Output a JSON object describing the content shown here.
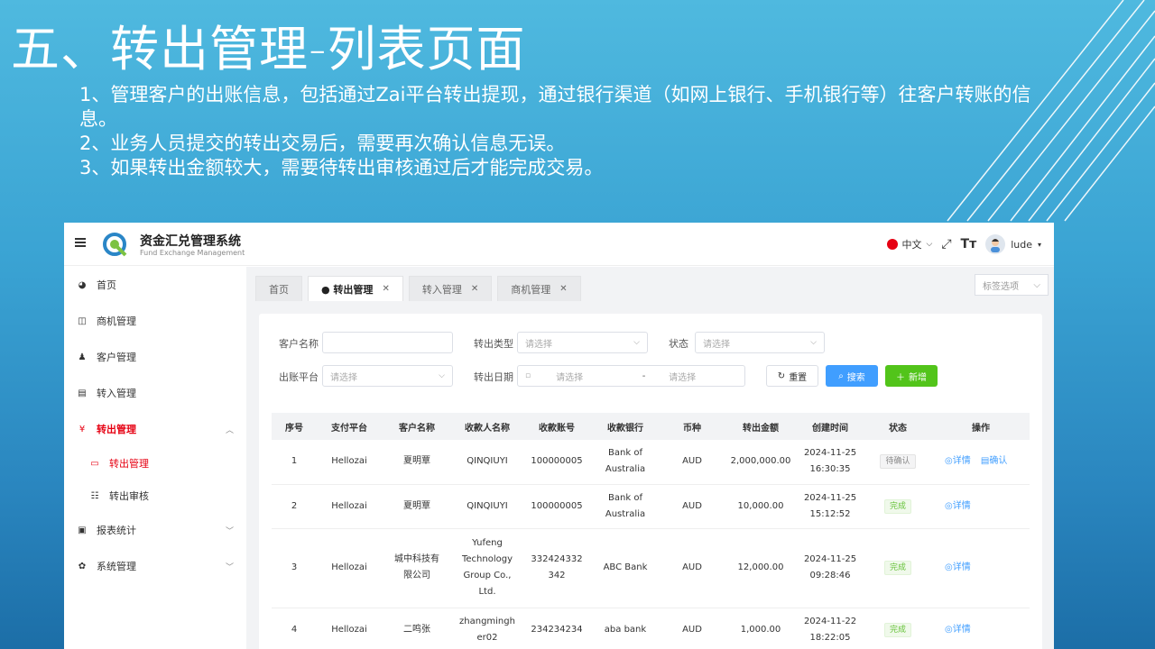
{
  "slide": {
    "title": "五、转出管理-列表页面",
    "bullets": [
      "1、管理客户的出账信息，包括通过Zai平台转出提现，通过银行渠道（如网上银行、手机银行等）往客户转账的信息。",
      "2、业务人员提交的转出交易后，需要再次确认信息无误。",
      "3、如果转出金额较大，需要待转出审核通过后才能完成交易。"
    ]
  },
  "app": {
    "brand": {
      "name": "资金汇兑管理系统",
      "subtitle": "Fund Exchange Management"
    },
    "header": {
      "language": "中文",
      "username": "lude"
    },
    "sidebar": {
      "items": [
        {
          "label": "首页",
          "icon": "dashboard-icon"
        },
        {
          "label": "商机管理",
          "icon": "book-icon"
        },
        {
          "label": "客户管理",
          "icon": "users-icon"
        },
        {
          "label": "转入管理",
          "icon": "import-icon"
        },
        {
          "label": "转出管理",
          "icon": "yen-icon",
          "active": true,
          "expanded": true,
          "children": [
            {
              "label": "转出管理",
              "icon": "list-icon",
              "active": true
            },
            {
              "label": "转出审核",
              "icon": "audit-icon"
            }
          ]
        },
        {
          "label": "报表统计",
          "icon": "monitor-icon"
        },
        {
          "label": "系统管理",
          "icon": "gear-icon"
        }
      ]
    },
    "tabs": [
      {
        "label": "首页",
        "closable": false
      },
      {
        "label": "● 转出管理",
        "closable": true,
        "active": true
      },
      {
        "label": "转入管理",
        "closable": true
      },
      {
        "label": "商机管理",
        "closable": true
      }
    ],
    "tab_options": "标签选项",
    "filters": {
      "customer_name": {
        "label": "客户名称",
        "value": ""
      },
      "transfer_type": {
        "label": "转出类型",
        "placeholder": "请选择"
      },
      "status": {
        "label": "状态",
        "placeholder": "请选择"
      },
      "platform": {
        "label": "出账平台",
        "placeholder": "请选择"
      },
      "date": {
        "label": "转出日期",
        "start_placeholder": "请选择",
        "separator": "-",
        "end_placeholder": "请选择"
      },
      "reset_label": "重置",
      "search_label": "搜索",
      "add_label": "新增"
    },
    "table": {
      "columns": [
        "序号",
        "支付平台",
        "客户名称",
        "收款人名称",
        "收款账号",
        "收款银行",
        "币种",
        "转出金额",
        "创建时间",
        "状态",
        "操作"
      ],
      "rows": [
        {
          "no": "1",
          "platform": "Hellozai",
          "customer": "夏明覃",
          "payee": "QINQIUYI",
          "account": "100000005",
          "bank": "Bank of Australia",
          "currency": "AUD",
          "amount": "2,000,000.00",
          "date": "2024-11-25",
          "time": "16:30:35",
          "status": "待确认",
          "status_type": "pending",
          "actions": [
            "详情",
            "确认"
          ]
        },
        {
          "no": "2",
          "platform": "Hellozai",
          "customer": "夏明覃",
          "payee": "QINQIUYI",
          "account": "100000005",
          "bank": "Bank of Australia",
          "currency": "AUD",
          "amount": "10,000.00",
          "date": "2024-11-25",
          "time": "15:12:52",
          "status": "完成",
          "status_type": "done",
          "actions": [
            "详情"
          ]
        },
        {
          "no": "3",
          "platform": "Hellozai",
          "customer": "城中科技有限公司",
          "payee": "Yufeng Technology Group Co., Ltd.",
          "account": "332424332342",
          "bank": "ABC Bank",
          "currency": "AUD",
          "amount": "12,000.00",
          "date": "2024-11-25",
          "time": "09:28:46",
          "status": "完成",
          "status_type": "done",
          "actions": [
            "详情"
          ]
        },
        {
          "no": "4",
          "platform": "Hellozai",
          "customer": "二鸣张",
          "payee": "zhangmingher02",
          "account": "234234234",
          "bank": "aba bank",
          "currency": "AUD",
          "amount": "1,000.00",
          "date": "2024-11-22",
          "time": "18:22:05",
          "status": "完成",
          "status_type": "done",
          "actions": [
            "详情"
          ]
        }
      ]
    },
    "colors": {
      "accent": "#e60012",
      "primary": "#409eff",
      "success": "#52c41a"
    }
  }
}
